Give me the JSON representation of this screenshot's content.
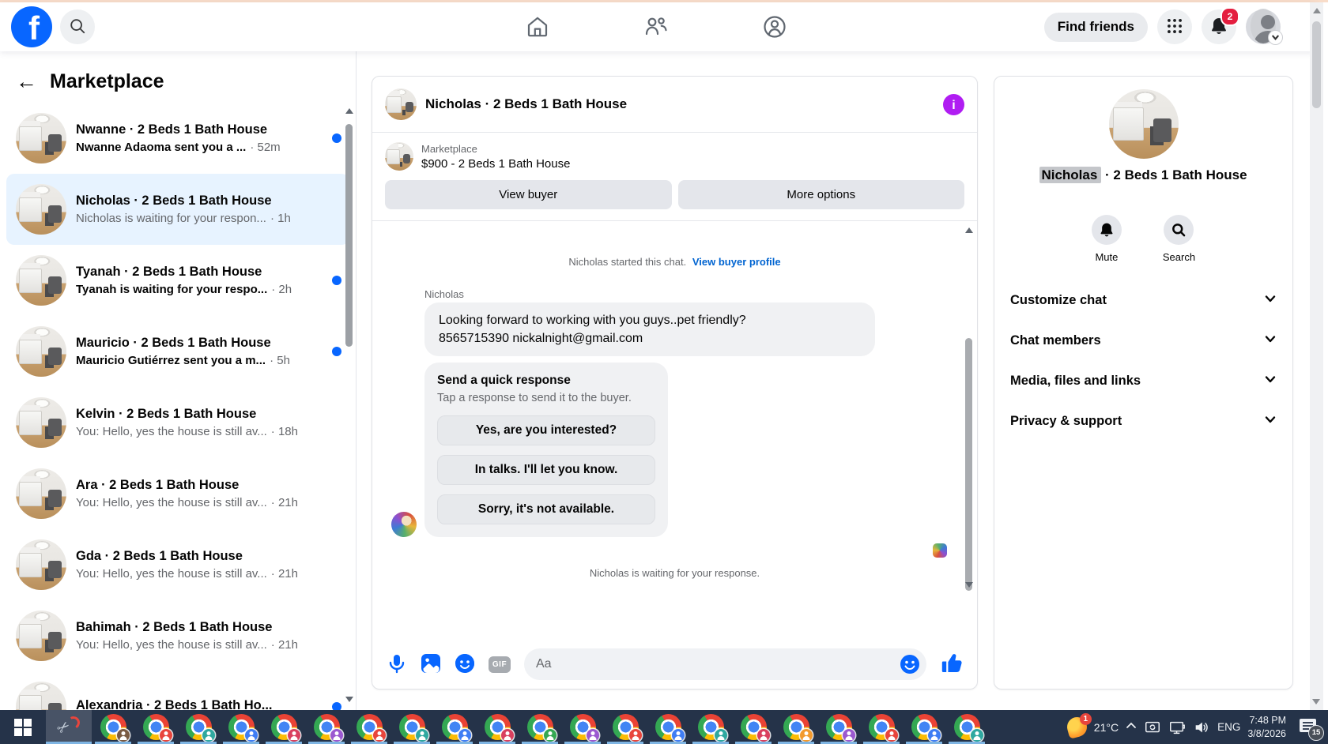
{
  "topnav": {
    "find_friends_label": "Find friends",
    "notification_count": "2"
  },
  "sidebar": {
    "title": "Marketplace",
    "conversations": [
      {
        "title": "Nwanne · 2 Beds 1 Bath House",
        "subtitle": "Nwanne Adaoma sent you a ...",
        "time": "· 52m",
        "state": "unread"
      },
      {
        "title": "Nicholas · 2 Beds 1 Bath House",
        "subtitle": "Nicholas is waiting for your respon...",
        "time": "· 1h",
        "state": "selected"
      },
      {
        "title": "Tyanah · 2 Beds 1 Bath House",
        "subtitle": "Tyanah is waiting for your respo...",
        "time": "· 2h",
        "state": "unread"
      },
      {
        "title": "Mauricio · 2 Beds 1 Bath House",
        "subtitle": "Mauricio Gutiérrez sent you a m...",
        "time": "· 5h",
        "state": "unread"
      },
      {
        "title": "Kelvin · 2 Beds 1 Bath House",
        "subtitle": "You: Hello, yes the house is still av...",
        "time": "· 18h",
        "state": "read"
      },
      {
        "title": "Ara · 2 Beds 1 Bath House",
        "subtitle": "You: Hello, yes the house is still av...",
        "time": "· 21h",
        "state": "read"
      },
      {
        "title": "Gda · 2 Beds 1 Bath House",
        "subtitle": "You: Hello, yes the house is still av...",
        "time": "· 21h",
        "state": "read"
      },
      {
        "title": "Bahimah · 2 Beds 1 Bath House",
        "subtitle": "You: Hello, yes the house is still av...",
        "time": "· 21h",
        "state": "read"
      },
      {
        "title": "Alexandria · 2 Beds 1 Bath Ho...",
        "subtitle": "",
        "time": "",
        "state": "unread"
      }
    ]
  },
  "chat": {
    "header_title": "Nicholas · 2 Beds 1 Bath House",
    "marketplace_label": "Marketplace",
    "listing": "$900 - 2 Beds 1 Bath House",
    "view_buyer_label": "View buyer",
    "more_options_label": "More options",
    "started_text": "Nicholas started this chat.",
    "view_profile_link": "View buyer profile",
    "sender_name": "Nicholas",
    "message_lines": [
      "Looking forward to working with you guys..pet friendly?",
      "8565715390 nickalnight@gmail.com"
    ],
    "quick_response": {
      "title": "Send a quick response",
      "subtitle": "Tap a response to send it to the buyer.",
      "options": [
        "Yes, are you interested?",
        "In talks. I'll let you know.",
        "Sorry, it's not available."
      ]
    },
    "waiting_text": "Nicholas is waiting for your response.",
    "input_placeholder": "Aa",
    "gif_label": "GIF"
  },
  "profile_panel": {
    "name_highlighted": "Nicholas",
    "title_rest": "· 2 Beds 1 Bath House",
    "mute_label": "Mute",
    "search_label": "Search",
    "sections": [
      "Customize chat",
      "Chat members",
      "Media, files and links",
      "Privacy & support"
    ]
  },
  "taskbar": {
    "weather_temp": "21°C",
    "weather_badge": "1",
    "language": "ENG",
    "time": "7:48 PM",
    "date": "3/8/2026",
    "tray_badge": "15",
    "chrome_profiles": [
      "#7a5b43",
      "#e8453c",
      "#2fa8a0",
      "#3f7df4",
      "#d9405f",
      "#9b59d0",
      "#e8453c",
      "#2fa8a0",
      "#3f7df4",
      "#d9405f",
      "#34a853",
      "#9b59d0",
      "#e8453c",
      "#3f7df4",
      "#2fa8a0",
      "#d9405f",
      "#f29a2e",
      "#9b59d0",
      "#e8453c",
      "#3f7df4",
      "#2fa8a0"
    ]
  },
  "colors": {
    "accent_blue": "#0866ff",
    "unread_dot": "#0866ff",
    "selected_conversation_bg": "#e7f3ff",
    "info_icon_purple": "#b01df2",
    "notification_badge_red": "#e41e3f",
    "taskbar_bg": "#253349",
    "taskbar_underline_blue": "#7fb5e3",
    "bubble_gray": "#f0f1f3",
    "button_gray": "#e4e6eb"
  }
}
